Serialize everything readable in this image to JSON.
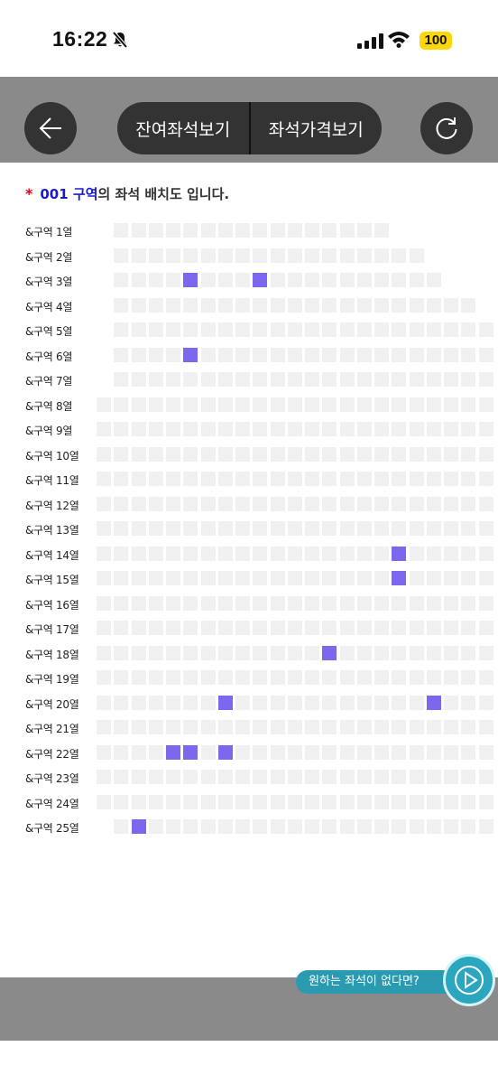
{
  "status_bar": {
    "time": "16:22",
    "battery": "100"
  },
  "toolbar": {
    "remaining_seats_label": "잔여좌석보기",
    "seat_price_label": "좌석가격보기"
  },
  "heading": {
    "star": "*",
    "zone_code": "001",
    "zone_word": "구역",
    "rest": "의 좌석 배치도 입니다."
  },
  "seat_map": {
    "rows": [
      {
        "label": "&구역 1열",
        "start_col": 1,
        "count": 16,
        "available": []
      },
      {
        "label": "&구역 2열",
        "start_col": 1,
        "count": 18,
        "available": []
      },
      {
        "label": "&구역 3열",
        "start_col": 1,
        "count": 19,
        "available": [
          4,
          8
        ]
      },
      {
        "label": "&구역 4열",
        "start_col": 1,
        "count": 21,
        "available": []
      },
      {
        "label": "&구역 5열",
        "start_col": 1,
        "count": 23,
        "available": []
      },
      {
        "label": "&구역 6열",
        "start_col": 1,
        "count": 23,
        "available": [
          4
        ]
      },
      {
        "label": "&구역 7열",
        "start_col": 1,
        "count": 23,
        "available": []
      },
      {
        "label": "&구역 8열",
        "start_col": 0,
        "count": 24,
        "available": []
      },
      {
        "label": "&구역 9열",
        "start_col": 0,
        "count": 24,
        "available": []
      },
      {
        "label": "&구역 10열",
        "start_col": 0,
        "count": 24,
        "available": []
      },
      {
        "label": "&구역 11열",
        "start_col": 0,
        "count": 24,
        "available": []
      },
      {
        "label": "&구역 12열",
        "start_col": 0,
        "count": 24,
        "available": []
      },
      {
        "label": "&구역 13열",
        "start_col": 0,
        "count": 24,
        "available": []
      },
      {
        "label": "&구역 14열",
        "start_col": 0,
        "count": 24,
        "available": [
          17
        ]
      },
      {
        "label": "&구역 15열",
        "start_col": 0,
        "count": 24,
        "available": [
          17
        ]
      },
      {
        "label": "&구역 16열",
        "start_col": 0,
        "count": 24,
        "available": []
      },
      {
        "label": "&구역 17열",
        "start_col": 0,
        "count": 24,
        "available": []
      },
      {
        "label": "&구역 18열",
        "start_col": 0,
        "count": 24,
        "available": [
          13
        ]
      },
      {
        "label": "&구역 19열",
        "start_col": 0,
        "count": 24,
        "available": []
      },
      {
        "label": "&구역 20열",
        "start_col": 0,
        "count": 24,
        "available": [
          7,
          19
        ]
      },
      {
        "label": "&구역 21열",
        "start_col": 0,
        "count": 24,
        "available": []
      },
      {
        "label": "&구역 22열",
        "start_col": 0,
        "count": 24,
        "available": [
          4,
          5,
          7
        ]
      },
      {
        "label": "&구역 23열",
        "start_col": 0,
        "count": 24,
        "available": []
      },
      {
        "label": "&구역 24열",
        "start_col": 0,
        "count": 24,
        "available": []
      },
      {
        "label": "&구역 25열",
        "start_col": 1,
        "count": 23,
        "available": [
          1
        ]
      }
    ]
  },
  "bottom": {
    "want_label": "원하는 좌석이 없다면?"
  },
  "colors": {
    "available_seat": "#7b68ee",
    "empty_seat": "#f0f0f0",
    "toolbar_bg": "#8a8a8a",
    "star": "#e0001b",
    "zone": "#1a1acc"
  },
  "icons": {
    "back": "arrow-left-icon",
    "refresh": "refresh-icon",
    "silent": "bell-slash-icon",
    "wifi": "wifi-icon",
    "play": "play-icon"
  }
}
